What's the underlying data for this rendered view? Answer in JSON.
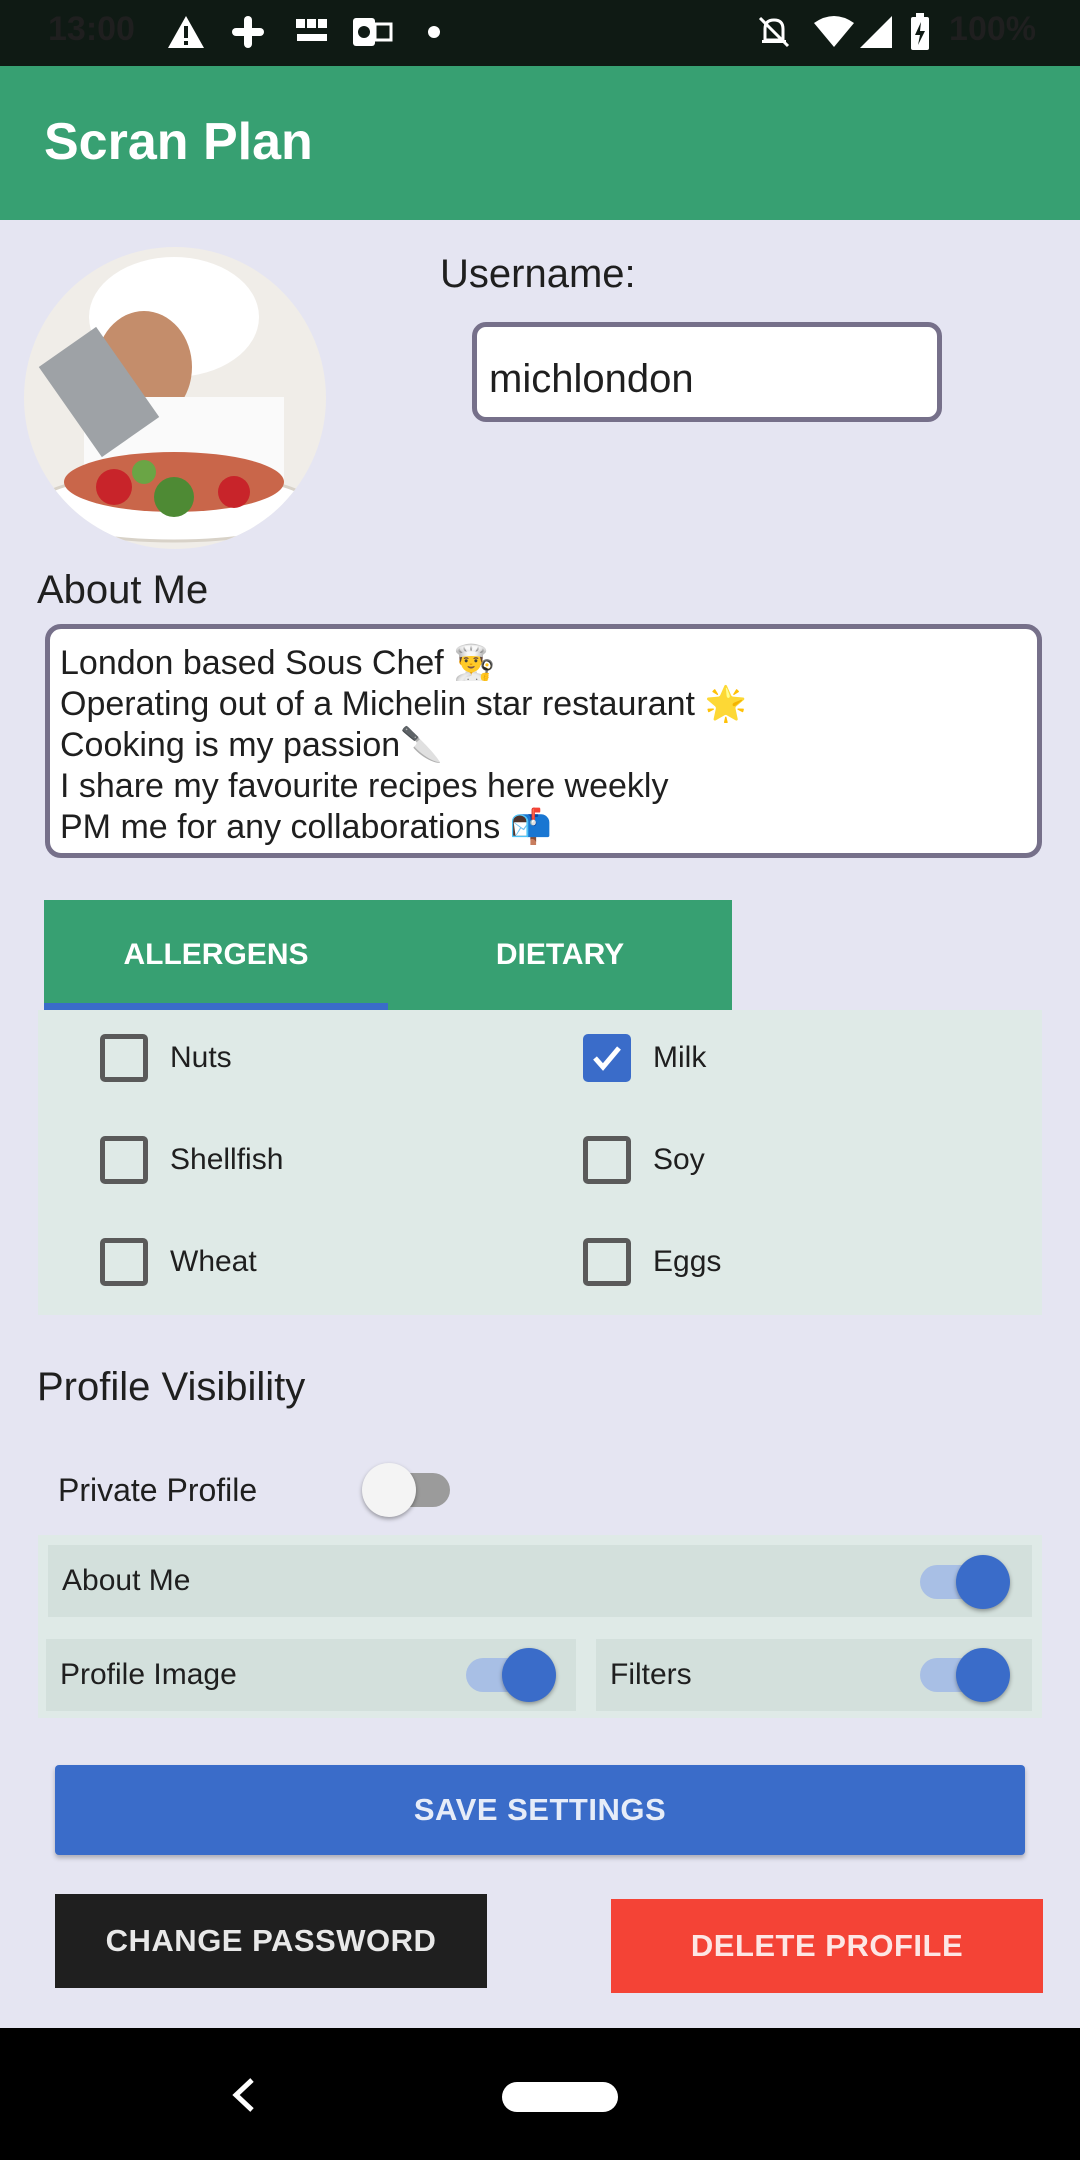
{
  "status_bar": {
    "time": "13:00",
    "battery": "100%",
    "icons": [
      "warning-icon",
      "slack-icon",
      "bbc-news-icon",
      "outlook-icon",
      "dot-icon",
      "mute-icon",
      "wifi-icon",
      "signal-icon",
      "battery-icon"
    ]
  },
  "app_bar": {
    "title": "Scran Plan"
  },
  "profile": {
    "username_label": "Username:",
    "username_value": "michlondon",
    "about_label": "About Me",
    "about_lines": [
      "London based Sous Chef 👨‍🍳",
      "Operating out of a Michelin star restaurant 🌟",
      "Cooking is my passion🔪",
      "I share my favourite recipes here weekly",
      "PM me for any collaborations 📬"
    ]
  },
  "tabs": [
    {
      "label": "ALLERGENS",
      "active": true
    },
    {
      "label": "DIETARY",
      "active": false
    }
  ],
  "allergens": [
    {
      "label": "Nuts",
      "checked": false
    },
    {
      "label": "Milk",
      "checked": true
    },
    {
      "label": "Shellfish",
      "checked": false
    },
    {
      "label": "Soy",
      "checked": false
    },
    {
      "label": "Wheat",
      "checked": false
    },
    {
      "label": "Eggs",
      "checked": false
    }
  ],
  "visibility": {
    "title": "Profile Visibility",
    "private_label": "Private Profile",
    "private_on": false,
    "about_label": "About Me",
    "about_on": true,
    "image_label": "Profile Image",
    "image_on": true,
    "filters_label": "Filters",
    "filters_on": true
  },
  "buttons": {
    "save": "SAVE SETTINGS",
    "change_password": "CHANGE PASSWORD",
    "delete": "DELETE PROFILE"
  },
  "colors": {
    "primary_green": "#37a072",
    "accent_blue": "#3a6cc9",
    "delete_red": "#f44336"
  }
}
